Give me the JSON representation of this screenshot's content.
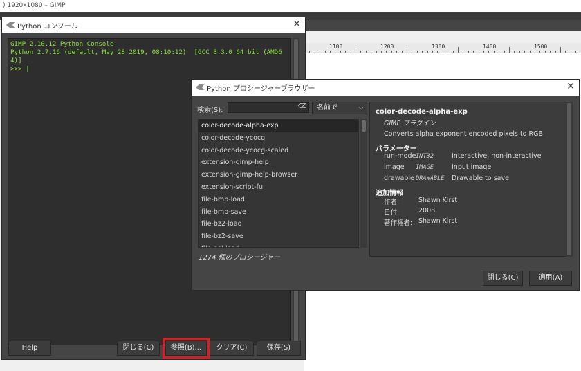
{
  "gimp": {
    "title": ") 1920x1080 – GIMP",
    "ruler": [
      "1100",
      "1200",
      "1300",
      "1400",
      "1500"
    ]
  },
  "console": {
    "title": "Python コンソール",
    "output": "GIMP 2.10.12 Python Console\nPython 2.7.16 (default, May 28 2019, 08:10:12)  [GCC 8.3.0 64 bit (AMD64)]\n>>> |",
    "buttons": {
      "help": "Help",
      "close": "閉じる(C)",
      "browse": "参照(B)...",
      "clear": "クリア(C)",
      "save": "保存(S)"
    },
    "highlight_color": "#e3191b"
  },
  "browser": {
    "title": "Python プロシージャーブラウザー",
    "search_label": "検索(S):",
    "search_value": "",
    "sort_selected": "名前で",
    "procedures": [
      "color-decode-alpha-exp",
      "color-decode-ycocg",
      "color-decode-ycocg-scaled",
      "extension-gimp-help",
      "extension-gimp-help-browser",
      "extension-script-fu",
      "file-bmp-load",
      "file-bmp-save",
      "file-bz2-load",
      "file-bz2-save",
      "file-cel-load"
    ],
    "count": "1274 個のプロシージャー",
    "detail": {
      "name": "color-decode-alpha-exp",
      "type": "GIMP プラグイン",
      "blurb": "Converts alpha exponent encoded pixels to RGB",
      "params_heading": "パラメーター",
      "params": [
        {
          "name": "run-mode",
          "type": "INT32",
          "desc": "Interactive, non-interactive"
        },
        {
          "name": "image",
          "type": "IMAGE",
          "desc": "Input image"
        },
        {
          "name": "drawable",
          "type": "DRAWABLE",
          "desc": "Drawable to save"
        }
      ],
      "extra_heading": "追加情報",
      "extra": [
        {
          "key": "作者:",
          "value": "Shawn Kirst"
        },
        {
          "key": "日付:",
          "value": "2008"
        },
        {
          "key": "著作権者:",
          "value": "Shawn Kirst"
        }
      ]
    },
    "buttons": {
      "close": "閉じる(C)",
      "apply": "適用(A)"
    }
  }
}
